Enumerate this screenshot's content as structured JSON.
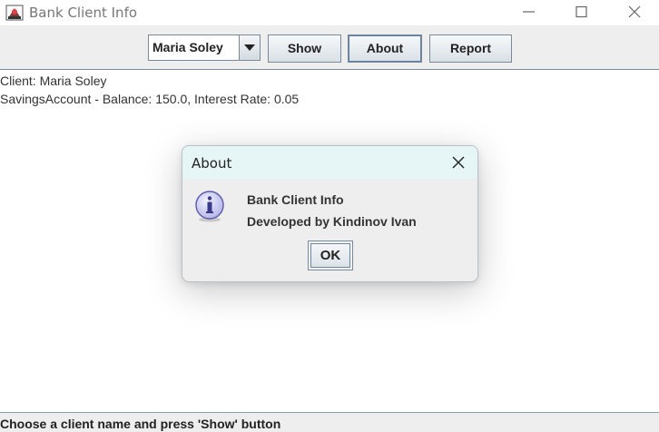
{
  "window": {
    "title": "Bank Client Info",
    "icon": "bank-app-icon"
  },
  "toolbar": {
    "client_selected": "Maria Soley",
    "show_label": "Show",
    "about_label": "About",
    "report_label": "Report"
  },
  "content": {
    "client_line": "Client: Maria Soley",
    "account_line": "SavingsAccount - Balance: 150.0, Interest Rate: 0.05"
  },
  "status": {
    "text": "Choose a client name and press 'Show' button"
  },
  "dialog": {
    "title": "About",
    "line1": "Bank Client Info",
    "line2": "Developed by Kindinov Ivan",
    "ok_label": "OK",
    "icon": "info-icon"
  },
  "colors": {
    "dialog_title_bg": "#e6f5f5",
    "panel_bg": "#eeeeee",
    "button_border": "#7a8a99",
    "info_icon_fill": "#c9c9f2"
  }
}
